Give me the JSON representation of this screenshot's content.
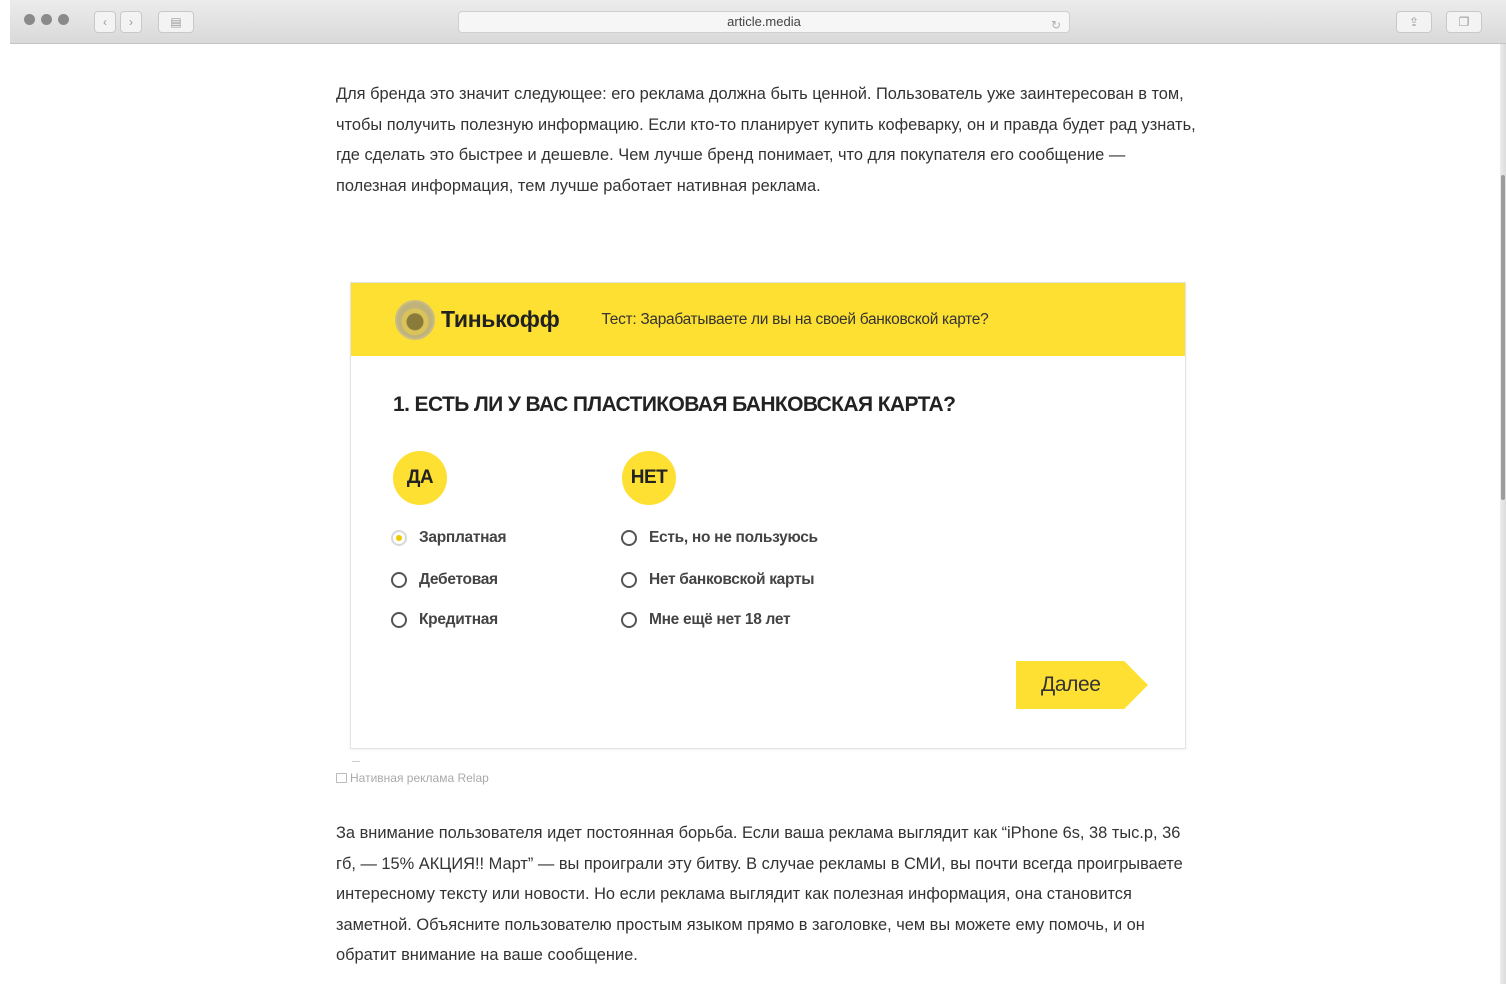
{
  "browser": {
    "url": "article.media"
  },
  "article": {
    "paragraph1": "Для бренда это значит следующее: его реклама должна быть ценной. Пользователь уже заинтересован в том, чтобы получить полезную информацию. Если кто-то планирует купить кофеварку, он и правда будет рад узнать, где сделать это быстрее и дешевле. Чем лучше бренд понимает, что для покупателя его сообщение — полезная информация, тем лучше работает нативная реклама.",
    "image_caption": "Нативная реклама Relap",
    "paragraph2": "За внимание пользователя идет постоянная борьба. Если ваша реклама выглядит как “iPhone 6s, 38 тыс.р, 36 гб, — 15% АКЦИЯ!! Март” — вы проиграли эту битву. В случае рекламы в СМИ, вы почти всегда проигрываете интересному тексту или новости. Но если реклама выглядит как полезная информация, она становится заметной. Объясните пользователю простым языком прямо в заголовке, чем вы можете ему помочь, и он обратит внимание на ваше сообщение."
  },
  "ad": {
    "brand": "Тинькофф",
    "tagline": "Тест: Зарабатываете ли вы на своей банковской карте?",
    "question": "1. ЕСТЬ ЛИ У ВАС ПЛАСТИКОВАЯ БАНКОВСКАЯ КАРТА?",
    "yes_label": "ДА",
    "no_label": "НЕТ",
    "yes_options": [
      "Зарплатная",
      "Дебетовая",
      "Кредитная"
    ],
    "no_options": [
      "Есть, но не пользуюсь",
      "Нет банковской карты",
      "Мне ещё нет 18 лет"
    ],
    "selected_option": "Зарплатная",
    "next_label": "Далее",
    "brand_color": "#fde032"
  },
  "icons": [
    "back-icon",
    "forward-icon",
    "sidebar-icon",
    "reload-icon",
    "share-icon",
    "tabs-icon",
    "image-icon"
  ]
}
